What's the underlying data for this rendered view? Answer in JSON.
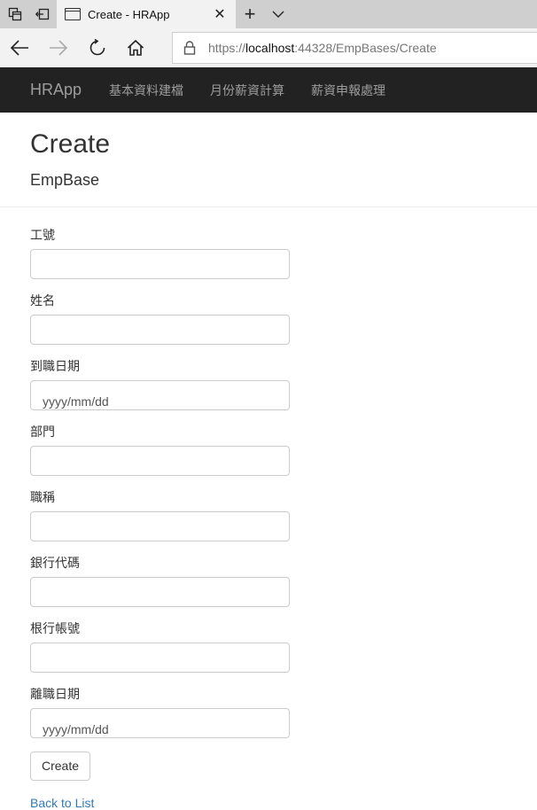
{
  "browser": {
    "tab_title": "Create - HRApp",
    "url_scheme": "https://",
    "url_host": "localhost",
    "url_rest": ":44328/EmpBases/Create"
  },
  "app": {
    "brand": "HRApp",
    "nav": [
      {
        "label": "基本資料建檔"
      },
      {
        "label": "月份薪資計算"
      },
      {
        "label": "薪資申報處理"
      }
    ]
  },
  "page": {
    "title": "Create",
    "subtitle": "EmpBase"
  },
  "form": {
    "fields": [
      {
        "label": "工號",
        "value": "",
        "placeholder": ""
      },
      {
        "label": "姓名",
        "value": "",
        "placeholder": ""
      },
      {
        "label": "到職日期",
        "value": "",
        "placeholder": "yyyy/mm/dd"
      },
      {
        "label": "部門",
        "value": "",
        "placeholder": ""
      },
      {
        "label": "職稱",
        "value": "",
        "placeholder": ""
      },
      {
        "label": "銀行代碼",
        "value": "",
        "placeholder": ""
      },
      {
        "label": "根行帳號",
        "value": "",
        "placeholder": ""
      },
      {
        "label": "離職日期",
        "value": "",
        "placeholder": "yyyy/mm/dd"
      }
    ],
    "submit_label": "Create",
    "back_label": "Back to List"
  },
  "colors": {
    "navbar_bg": "#222222",
    "navbar_text": "#9d9d9d",
    "link": "#337ab7"
  }
}
